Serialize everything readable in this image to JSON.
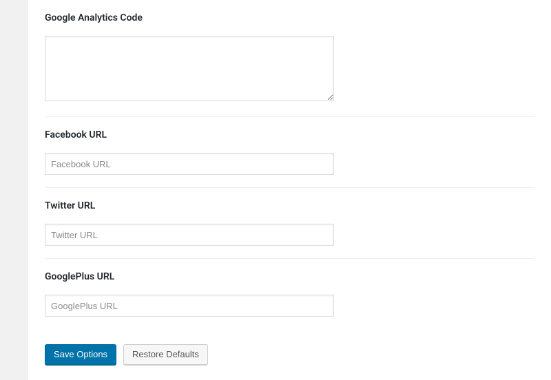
{
  "sections": {
    "ga": {
      "label": "Google Analytics Code",
      "value": ""
    },
    "facebook": {
      "label": "Facebook URL",
      "placeholder": "Facebook URL",
      "value": ""
    },
    "twitter": {
      "label": "Twitter URL",
      "placeholder": "Twitter URL",
      "value": ""
    },
    "googleplus": {
      "label": "GooglePlus URL",
      "placeholder": "GooglePlus URL",
      "value": ""
    }
  },
  "buttons": {
    "save": "Save Options",
    "restore": "Restore Defaults"
  }
}
